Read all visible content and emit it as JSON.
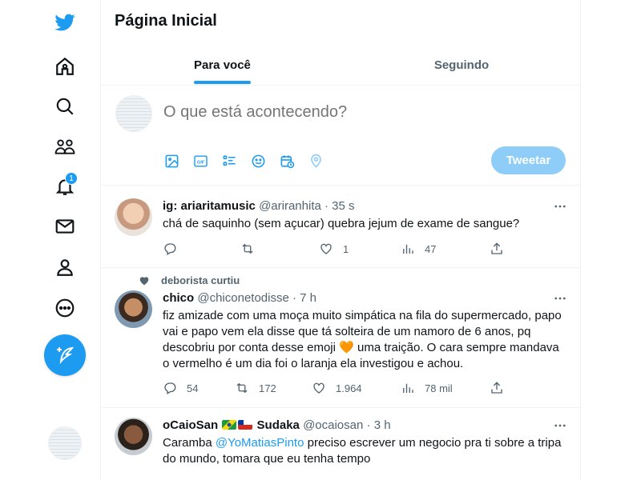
{
  "colors": {
    "accent": "#1d9bf0",
    "tweet_button_disabled": "#8ecdf7",
    "secondary_text": "#536471",
    "primary_text": "#0f1419"
  },
  "nav": {
    "items": [
      {
        "icon": "twitter-logo-icon"
      },
      {
        "icon": "home-icon"
      },
      {
        "icon": "search-icon"
      },
      {
        "icon": "communities-icon"
      },
      {
        "icon": "notifications-bell-icon",
        "badge": "1"
      },
      {
        "icon": "messages-envelope-icon"
      },
      {
        "icon": "profile-icon"
      },
      {
        "icon": "more-circle-icon"
      }
    ],
    "compose_icon": "feather-plus-icon"
  },
  "header": {
    "title": "Página Inicial"
  },
  "tabs": [
    {
      "label": "Para você",
      "active": true
    },
    {
      "label": "Seguindo",
      "active": false
    }
  ],
  "composer": {
    "placeholder": "O que está acontecendo?",
    "tools": [
      "image-icon",
      "gif-icon",
      "poll-icon",
      "emoji-icon",
      "schedule-icon",
      "location-icon"
    ],
    "tweet_button": "Tweetar"
  },
  "tweets": [
    {
      "name": "ig: ariaritamusic",
      "handle": "@ariranhita",
      "time": "35 s",
      "text": "chá de saquinho (sem açucar) quebra jejum de exame de sangue?",
      "replies": "",
      "retweets": "",
      "likes": "1",
      "views": "47"
    },
    {
      "context": "deborista curtiu",
      "name": "chico",
      "handle": "@chiconetodisse",
      "time": "7 h",
      "text_before_emoji": "fiz amizade com uma moça muito simpática na fila do supermercado, papo vai e papo vem ela disse que tá solteira de um namoro de 6 anos, pq descobriu por conta desse emoji ",
      "emoji": "🧡",
      "text_after_emoji": " uma traição. O cara sempre mandava o vermelho é um dia foi o laranja ela investigou e achou.",
      "replies": "54",
      "retweets": "172",
      "likes": "1.964",
      "views": "78 mil"
    },
    {
      "name_prefix": "oCaioSan",
      "name_suffix": "Sudaka",
      "handle": "@ocaiosan",
      "time": "3 h",
      "text_before_mention": "Caramba ",
      "mention": "@YoMatiasPinto",
      "text_after_mention": " preciso escrever um negocio pra ti sobre a tripa do mundo, tomara que eu tenha tempo"
    }
  ]
}
